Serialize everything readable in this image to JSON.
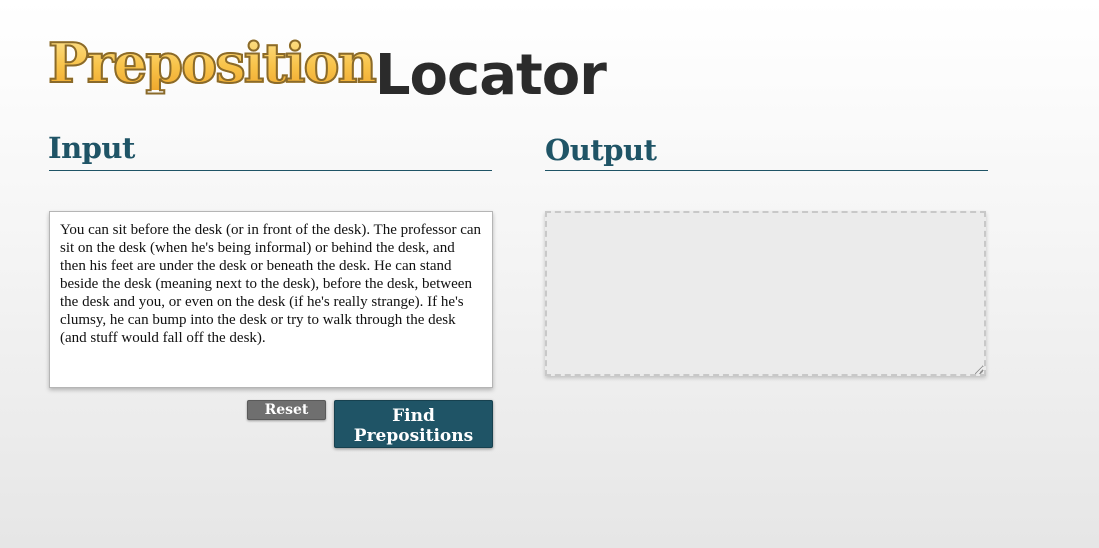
{
  "logo": {
    "part1": "Preposition",
    "part2": "Locator"
  },
  "input": {
    "heading": "Input",
    "text": "You can sit before the desk (or in front of the desk). The professor can sit on the desk (when he's being informal) or behind the desk, and then his feet are under the desk or beneath the desk. He can stand beside the desk (meaning next to the desk), before the desk, between the desk and you, or even on the desk (if he's really strange). If he's clumsy, he can bump into the desk or try to walk through the desk (and stuff would fall off the desk)."
  },
  "output": {
    "heading": "Output",
    "text": ""
  },
  "buttons": {
    "reset_label": "Reset",
    "find_label_line1": "Find",
    "find_label_line2": "Prepositions"
  },
  "colors": {
    "accent": "#1f5466",
    "logo_gold": "#f6c042",
    "logo_dark": "#2b2b2b",
    "reset_gray": "#6f6f6f"
  }
}
